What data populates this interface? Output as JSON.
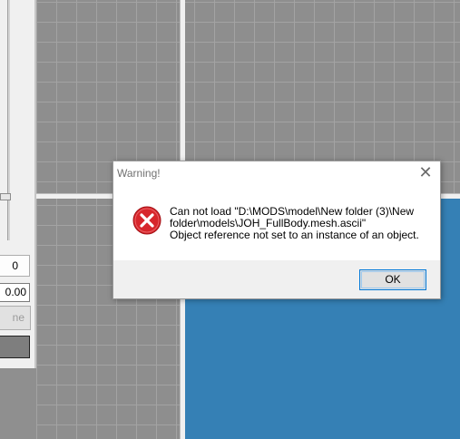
{
  "side_panel": {
    "count_value": "0",
    "numeric_value": "0.00",
    "cut_button_label": "ne"
  },
  "dialog": {
    "title": "Warning!",
    "close_symbol": "✕",
    "icon": "error-icon",
    "message": "Can not load \"D:\\MODS\\model\\New folder (3)\\New\nfolder\\models\\JOH_FullBody.mesh.ascii\"\nObject reference not set to an instance of an object.",
    "ok_label": "OK"
  },
  "colors": {
    "viewport_blue": "#3580b5",
    "grid_gray": "#8e8e8e",
    "error_red": "#d7262b",
    "focus_blue": "#0078d7"
  }
}
